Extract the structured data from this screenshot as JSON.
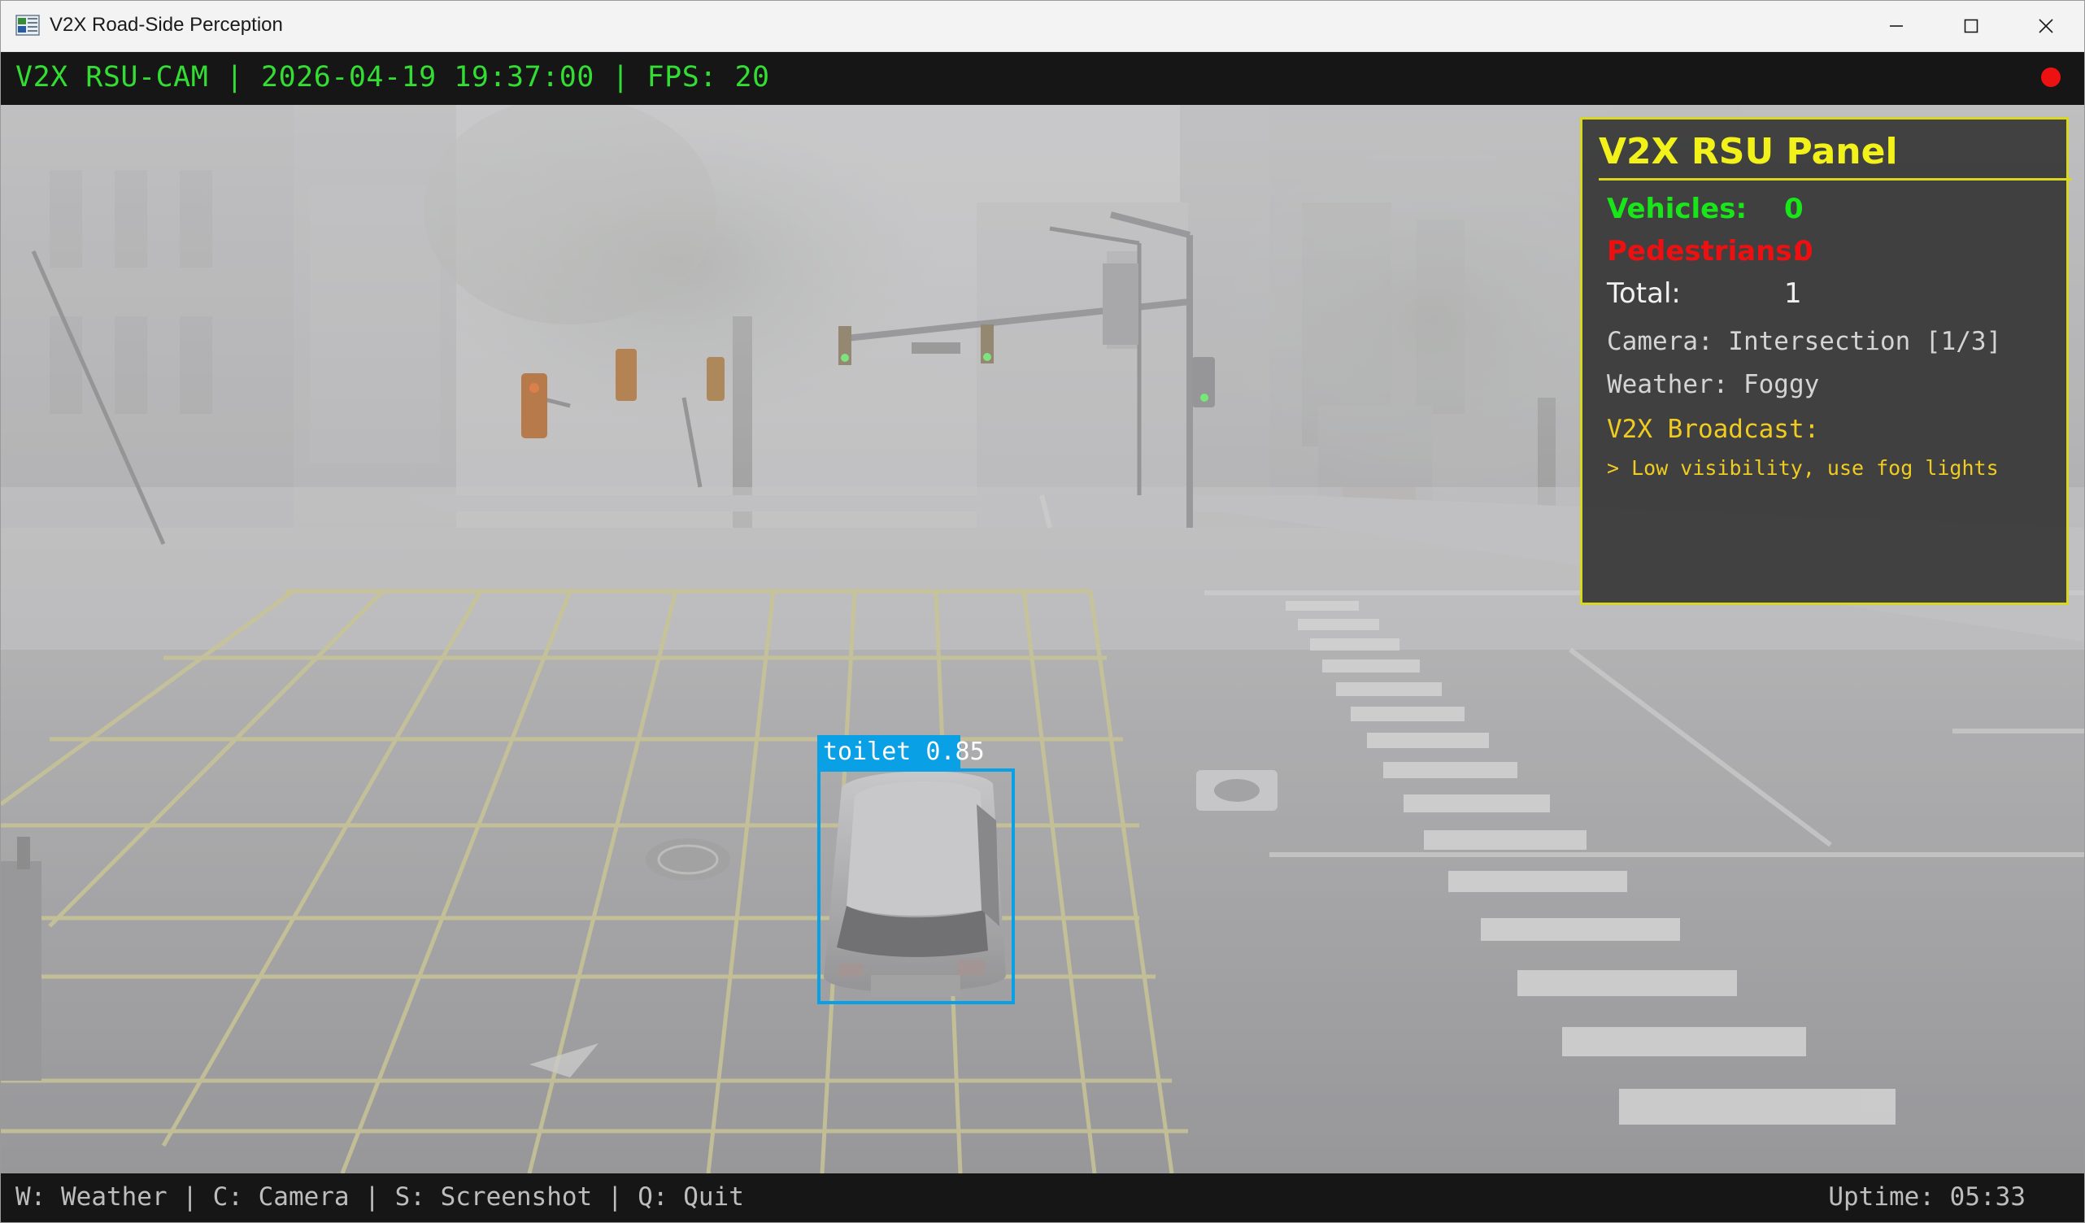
{
  "window": {
    "title": "V2X Road-Side Perception",
    "app_icon": "window-app-icon",
    "controls": [
      "minimize-icon",
      "maximize-icon",
      "close-icon"
    ]
  },
  "overlay_top": {
    "status_text": "V2X RSU-CAM | 2026-04-19 19:37:00 | FPS: 20",
    "recording_indicator": "rec-dot-icon",
    "text_color": "#33dd33",
    "rec_color": "#ee1111"
  },
  "detection": {
    "label": "toilet 0.85",
    "box_color": "#0aa0e6"
  },
  "panel": {
    "title": "V2X RSU Panel",
    "vehicles_label": "Vehicles:",
    "vehicles_value": "0",
    "pedestrians_label": "Pedestrians:",
    "pedestrians_value": "0",
    "total_label": "Total:",
    "total_value": "1",
    "camera": "Camera: Intersection [1/3]",
    "weather": "Weather: Foggy",
    "broadcast_label": "V2X Broadcast:",
    "broadcast_message": "> Low visibility, use fog lights",
    "border_color": "#d8d820",
    "vehicles_color": "#19e619",
    "pedestrians_color": "#ee1010",
    "broadcast_color": "#f0cc20"
  },
  "overlay_bottom": {
    "help_text": "W: Weather | C: Camera | S: Screenshot | Q: Quit",
    "uptime": "Uptime: 05:33"
  }
}
